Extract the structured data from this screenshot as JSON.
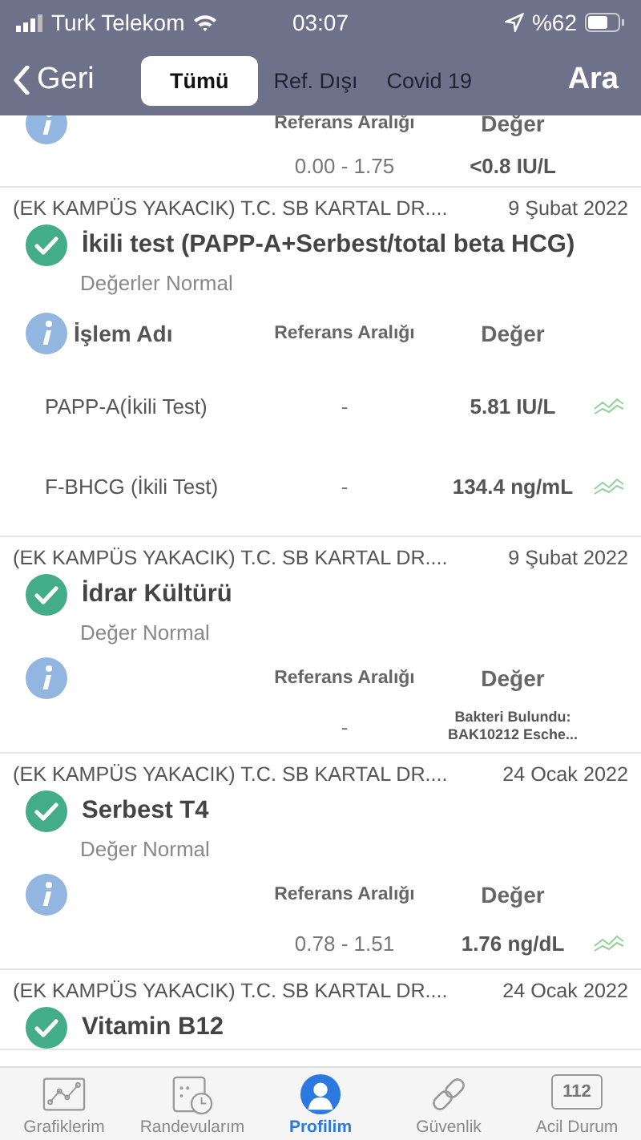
{
  "status_bar": {
    "carrier": "Turk Telekom",
    "time": "03:07",
    "battery": "%62"
  },
  "nav": {
    "back": "Geri",
    "search": "Ara",
    "tabs": [
      {
        "label": "Tümü",
        "selected": true
      },
      {
        "label": "Ref. Dışı",
        "selected": false
      },
      {
        "label": "Covid 19",
        "selected": false
      }
    ]
  },
  "records": [
    {
      "kind": "partial",
      "table": {
        "columns": [
          "Referans Aralığı",
          "Değer"
        ],
        "rows": [
          {
            "range": "0.00 - 1.75",
            "value": "<0.8 IU/L",
            "trend": false
          }
        ]
      }
    },
    {
      "kind": "full",
      "source": "(EK KAMPÜS YAKACIK) T.C. SB KARTAL DR....",
      "date": "9 Şubat 2022",
      "title": "İkili test (PAPP-A+Serbest/total beta HCG)",
      "status": "Değerler Normal",
      "table": {
        "name_column": "İşlem Adı",
        "columns": [
          "Referans Aralığı",
          "Değer"
        ],
        "rows": [
          {
            "name": "PAPP-A(İkili Test)",
            "range": "-",
            "value": "5.81 IU/L",
            "trend": true
          },
          {
            "name": "F-BHCG (İkili Test)",
            "range": "-",
            "value": "134.4 ng/mL",
            "trend": true
          }
        ]
      }
    },
    {
      "kind": "full",
      "source": "(EK KAMPÜS YAKACIK) T.C. SB KARTAL DR....",
      "date": "9 Şubat 2022",
      "title": "İdrar Kültürü",
      "status": "Değer Normal",
      "table": {
        "columns": [
          "Referans Aralığı",
          "Değer"
        ],
        "rows": [
          {
            "range": "-",
            "value": "Bakteri Bulundu: BAK10212 Esche...",
            "trend": false,
            "kind": "note"
          }
        ]
      }
    },
    {
      "kind": "full",
      "source": "(EK KAMPÜS YAKACIK) T.C. SB KARTAL DR....",
      "date": "24 Ocak 2022",
      "title": "Serbest T4",
      "status": "Değer Normal",
      "table": {
        "columns": [
          "Referans Aralığı",
          "Değer"
        ],
        "rows": [
          {
            "range": "0.78 - 1.51",
            "value": "1.76 ng/dL",
            "trend": true
          }
        ]
      }
    },
    {
      "kind": "head",
      "source": "(EK KAMPÜS YAKACIK) T.C. SB KARTAL DR....",
      "date": "24 Ocak 2022",
      "title": "Vitamin B12"
    }
  ],
  "tab_bar": [
    {
      "label": "Grafiklerim",
      "kind": "chart",
      "selected": false
    },
    {
      "label": "Randevularım",
      "kind": "calendar",
      "selected": false
    },
    {
      "label": "Profilim",
      "kind": "person",
      "selected": true
    },
    {
      "label": "Güvenlik",
      "kind": "link",
      "selected": false
    },
    {
      "label": "Acil Durum",
      "kind": "emergency",
      "icon_text": "112",
      "selected": false
    }
  ]
}
